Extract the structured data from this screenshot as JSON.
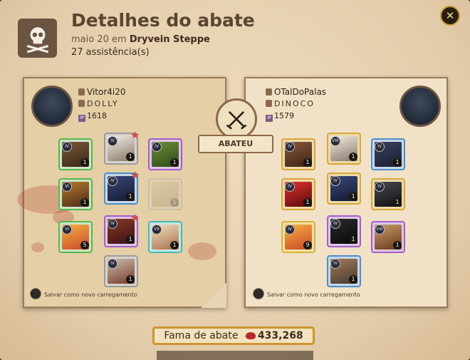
{
  "header": {
    "title": "Detalhes do abate",
    "date": "maio 20 em",
    "location": "Dryvein Steppe",
    "assists": "27 assistência(s)"
  },
  "killer": {
    "name": "Vitor4i20",
    "guild": "DOLLY",
    "ip": "1618",
    "save_label": "Salvar como novo carregamento",
    "slots": [
      {
        "icon": "bag",
        "quality": "green",
        "tier": "IV",
        "qty": "1"
      },
      {
        "icon": "cape-white",
        "quality": "gray",
        "tier": "IV",
        "qty": "1"
      },
      {
        "icon": "leaf-weapon",
        "quality": "purple",
        "tier": "IV",
        "qty": "1"
      },
      {
        "icon": "fire-staff",
        "quality": "green",
        "tier": "VI",
        "qty": "1"
      },
      {
        "icon": "armor",
        "quality": "blue",
        "tier": "IV",
        "qty": "1"
      },
      {
        "icon": "empty-offhand",
        "quality": "gray",
        "tier": "",
        "qty": "1"
      },
      {
        "icon": "potion",
        "quality": "green",
        "tier": "VI",
        "qty": "5"
      },
      {
        "icon": "boots",
        "quality": "purple",
        "tier": "IV",
        "qty": "1"
      },
      {
        "icon": "sandwich",
        "quality": "teal",
        "tier": "VII",
        "qty": "1"
      },
      {
        "icon": "mount",
        "quality": "gray",
        "tier": "IV",
        "qty": "1"
      }
    ]
  },
  "victim": {
    "name": "OTalDoPalas",
    "guild": "DINOCO",
    "ip": "1579",
    "save_label": "Salvar como novo carregamento",
    "slots": [
      {
        "icon": "bag",
        "quality": "gold",
        "tier": "IV",
        "qty": "1"
      },
      {
        "icon": "cape-white",
        "quality": "gold",
        "tier": "VIII",
        "qty": "1"
      },
      {
        "icon": "mace-head",
        "quality": "blue",
        "tier": "IV",
        "qty": "1"
      },
      {
        "icon": "red-sword",
        "quality": "gold",
        "tier": "IV",
        "qty": "1"
      },
      {
        "icon": "robe",
        "quality": "gold",
        "tier": "IV",
        "qty": "1"
      },
      {
        "icon": "mace",
        "quality": "gold",
        "tier": "IV",
        "qty": "1"
      },
      {
        "icon": "potion",
        "quality": "gold",
        "tier": "IV",
        "qty": "9"
      },
      {
        "icon": "boots",
        "quality": "purple",
        "tier": "IV",
        "qty": "1"
      },
      {
        "icon": "soup",
        "quality": "purple",
        "tier": "VIII",
        "qty": "1"
      },
      {
        "icon": "ox-mount",
        "quality": "blue",
        "tier": "IV",
        "qty": "1"
      }
    ]
  },
  "center": {
    "label": "ABATEU"
  },
  "fame": {
    "label": "Fama de abate",
    "value": "433,268"
  },
  "colors": {
    "accent_gold": "#c9962f",
    "text_dark": "#3d2c1e"
  }
}
